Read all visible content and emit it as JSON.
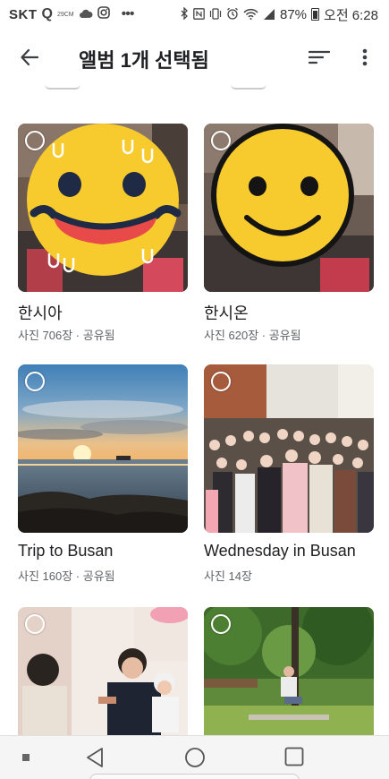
{
  "status_bar": {
    "carrier": "SKT",
    "temperature": "29CM",
    "battery": "87%",
    "time": "오전 6:28",
    "icons": [
      "q-icon",
      "cloud-icon",
      "instagram-icon",
      "more-dots-icon",
      "bluetooth-icon",
      "nfc-icon",
      "vibrate-icon",
      "alarm-icon",
      "wifi-icon",
      "signal-icon",
      "battery-icon"
    ]
  },
  "app_bar": {
    "title": "앨범 1개 선택됨",
    "back_icon": "arrow-back-icon",
    "sort_icon": "sort-icon",
    "more_icon": "more-vert-icon"
  },
  "albums": [
    {
      "name": "한시아",
      "meta": "사진 706장 · 공유됨",
      "thumbnail": "face-covered-emoji-drool"
    },
    {
      "name": "한시온",
      "meta": "사진 620장 · 공유됨",
      "thumbnail": "face-covered-emoji-smile"
    },
    {
      "name": "Trip to Busan",
      "meta": "사진 160장 · 공유됨",
      "thumbnail": "sunset-over-sea"
    },
    {
      "name": "Wednesday in Busan",
      "meta": "사진 14장",
      "thumbnail": "group-photo-formal"
    },
    {
      "name": "",
      "meta": "",
      "thumbnail": "family-event"
    },
    {
      "name": "",
      "meta": "",
      "thumbnail": "child-in-park"
    }
  ],
  "nav_bar": {
    "icons": [
      "recents-square-small-icon",
      "back-triangle-icon",
      "home-circle-icon",
      "overview-square-icon"
    ]
  },
  "colors": {
    "emoji_yellow": "#f7ca2d",
    "emoji_dark": "#1f2a44",
    "drool_red": "#e84a4a",
    "accent": "#1a73e8"
  }
}
